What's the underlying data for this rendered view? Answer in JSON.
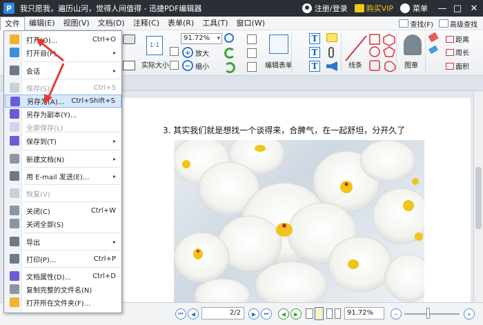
{
  "titlebar": {
    "title": "我只愿我，遍历山河，觉得人间值得 - 迅捷PDF编辑器",
    "login": "注册/登录",
    "vip": "购买VIP",
    "menu": "菜单",
    "minimize": "—",
    "maximize": "□",
    "close": "✕"
  },
  "menubar": {
    "items": [
      "文件",
      "编辑(E)",
      "视图(V)",
      "文档(D)",
      "注释(C)",
      "表单(R)",
      "工具(T)",
      "窗口(W)"
    ],
    "search": "查找(F)",
    "advanced_search": "高级查找"
  },
  "ribbon": {
    "zoom_value": "91.72%",
    "zoom_in": "放大",
    "zoom_out": "缩小",
    "actual_size": "实际大小",
    "edit_form": "编辑表单",
    "lines": "线条",
    "stamp": "图章",
    "distance": "距离",
    "perimeter": "周长",
    "area": "面积"
  },
  "document": {
    "line_text": "3.  其实我们就是想找一个谈得来，合脾气，在一起舒坦，分开久了"
  },
  "statusbar": {
    "page": "2/2",
    "zoom": "91.72%"
  },
  "file_menu": {
    "items": [
      {
        "label": "打开(O)...",
        "shortcut": "Ctrl+O",
        "arrow": "",
        "disabled": false
      },
      {
        "label": "打开自(F)",
        "shortcut": "",
        "arrow": "▸",
        "disabled": false
      },
      {
        "label": "会话",
        "shortcut": "",
        "arrow": "▸",
        "disabled": false
      },
      {
        "label": "保存(S)",
        "shortcut": "Ctrl+S",
        "arrow": "",
        "disabled": true
      },
      {
        "label": "另存为(A)...",
        "shortcut": "Ctrl+Shift+S",
        "arrow": "",
        "disabled": false
      },
      {
        "label": "另存为副本(Y)...",
        "shortcut": "",
        "arrow": "",
        "disabled": false
      },
      {
        "label": "全部保存(L)",
        "shortcut": "",
        "arrow": "",
        "disabled": true
      },
      {
        "label": "保存到(T)",
        "shortcut": "",
        "arrow": "▸",
        "disabled": false
      },
      {
        "label": "新建文档(N)",
        "shortcut": "",
        "arrow": "▸",
        "disabled": false
      },
      {
        "label": "用 E-mail 发送(E)...",
        "shortcut": "",
        "arrow": "▸",
        "disabled": false
      },
      {
        "label": "恢复(V)",
        "shortcut": "",
        "arrow": "",
        "disabled": true
      },
      {
        "label": "关闭(C)",
        "shortcut": "Ctrl+W",
        "arrow": "",
        "disabled": false
      },
      {
        "label": "关闭全部(S)",
        "shortcut": "",
        "arrow": "",
        "disabled": false
      },
      {
        "label": "导出",
        "shortcut": "",
        "arrow": "▸",
        "disabled": false
      },
      {
        "label": "打印(P)...",
        "shortcut": "Ctrl+P",
        "arrow": "",
        "disabled": false
      },
      {
        "label": "文档属性(D)...",
        "shortcut": "Ctrl+D",
        "arrow": "",
        "disabled": false
      },
      {
        "label": "复制完整的文件名(N)",
        "shortcut": "",
        "arrow": "",
        "disabled": false
      },
      {
        "label": "打开所在文件夹(F)...",
        "shortcut": "",
        "arrow": "",
        "disabled": false
      }
    ]
  },
  "colors": {
    "titlebar_bg": "#2a2f35",
    "accent_blue": "#2e76c9",
    "highlight": "#d7e8fb",
    "red_annotation": "#e53935"
  }
}
